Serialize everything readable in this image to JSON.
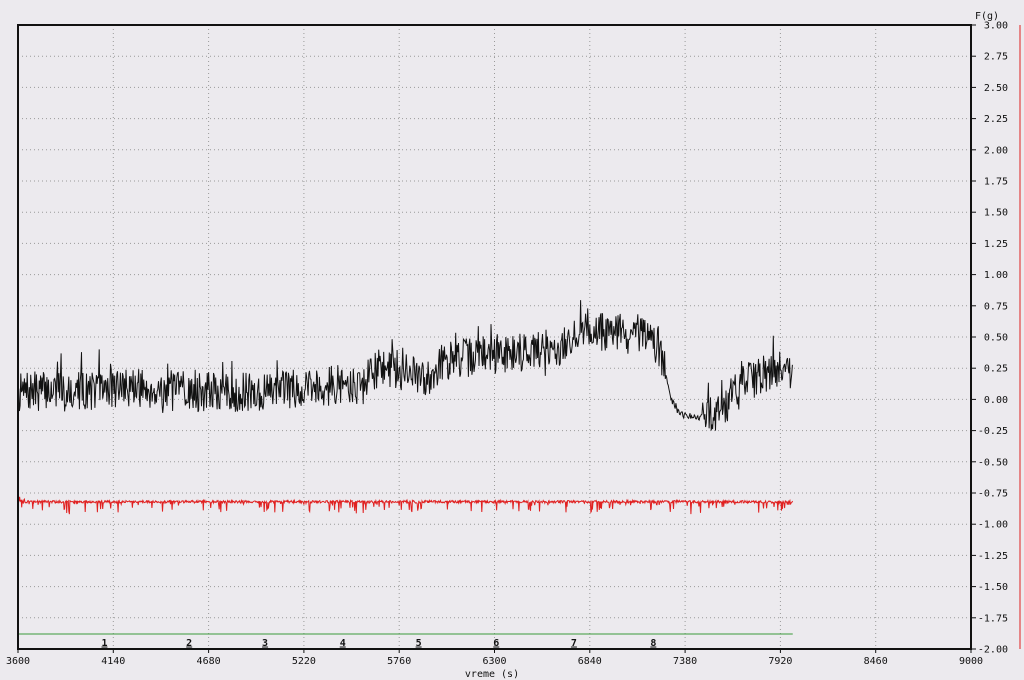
{
  "chart_data": {
    "type": "line",
    "title": "",
    "xlabel": "vreme (s)",
    "ylabel": "F(g)",
    "xlim": [
      3600,
      9000
    ],
    "ylim": [
      -2.0,
      3.0
    ],
    "x_ticks": [
      "3600",
      "4140",
      "4680",
      "5220",
      "5760",
      "6300",
      "6840",
      "7380",
      "7920",
      "8460",
      "9000"
    ],
    "y_ticks": [
      "3.00",
      "2.75",
      "2.50",
      "2.25",
      "2.00",
      "1.75",
      "1.50",
      "1.25",
      "1.00",
      "0.75",
      "0.50",
      "0.25",
      "0.00",
      "-0.25",
      "-0.50",
      "-0.75",
      "-1.00",
      "-1.25",
      "-1.50",
      "-1.75",
      "-2.00"
    ],
    "grid": true,
    "colors": {
      "force": "#111111",
      "reference": "#e02020",
      "event_line": "#3a9a3a",
      "background": "#eceaee",
      "grid": "#9a9a9a"
    },
    "series": [
      {
        "x": [
          3600,
          3800,
          4000,
          4200,
          4400,
          4600,
          4800,
          5000,
          5200,
          5400,
          5550,
          5650,
          5700,
          5800,
          5900,
          6000,
          6200,
          6400,
          6600,
          6700,
          6800,
          6900,
          7000,
          7100,
          7200,
          7260,
          7300,
          7350,
          7450,
          7520,
          7600,
          7700,
          7800,
          7900,
          7990
        ],
        "values": [
          0.05,
          0.08,
          0.07,
          0.1,
          0.08,
          0.06,
          0.05,
          0.06,
          0.1,
          0.12,
          0.11,
          0.26,
          0.24,
          0.22,
          0.15,
          0.3,
          0.35,
          0.38,
          0.4,
          0.42,
          0.58,
          0.55,
          0.54,
          0.5,
          0.48,
          0.3,
          0.0,
          -0.12,
          -0.15,
          -0.12,
          -0.05,
          0.1,
          0.2,
          0.25,
          0.22
        ]
      },
      {
        "x": [
          3600,
          7990
        ],
        "values": [
          -0.82,
          -0.82
        ]
      },
      {
        "x": [
          3600,
          7990
        ],
        "values": [
          -1.88,
          -1.88
        ]
      }
    ],
    "event_markers": [
      {
        "label": "1",
        "x": 4090
      },
      {
        "label": "2",
        "x": 4570
      },
      {
        "label": "3",
        "x": 5000
      },
      {
        "label": "4",
        "x": 5440
      },
      {
        "label": "5",
        "x": 5870
      },
      {
        "label": "6",
        "x": 6310
      },
      {
        "label": "7",
        "x": 6750
      },
      {
        "label": "8",
        "x": 7200
      }
    ]
  }
}
